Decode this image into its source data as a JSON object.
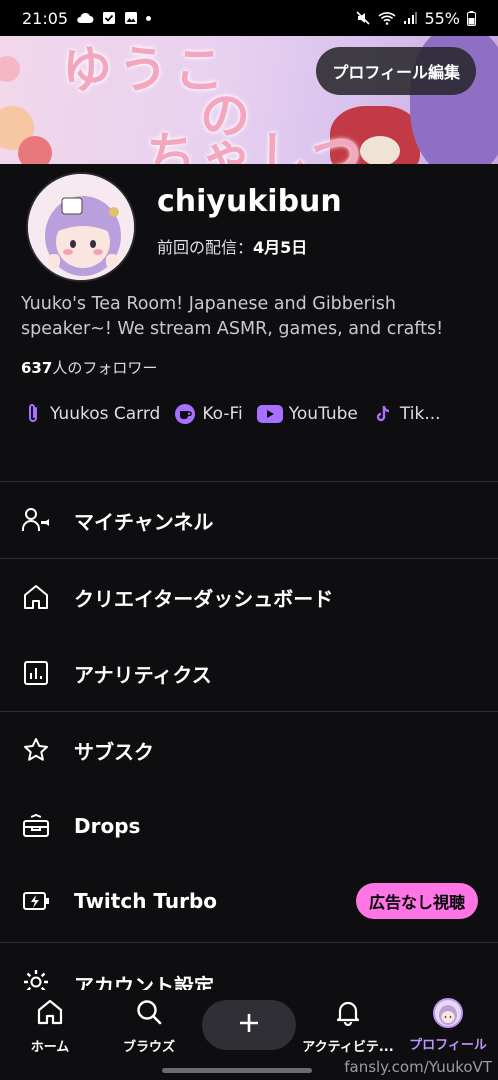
{
  "status_bar": {
    "time": "21:05",
    "battery": "55%"
  },
  "banner": {
    "text_line1": "ゆうこ",
    "text_line2": "の",
    "text_line3": "ちゃしつ",
    "edit_button": "プロフィール編集"
  },
  "profile": {
    "username": "chiyukibun",
    "last_stream_label": "前回の配信：",
    "last_stream_date": "4月5日",
    "bio": "Yuuko's Tea Room! Japanese and Gibberish speaker~! We stream ASMR, games, and crafts!",
    "followers_count": "637",
    "followers_label": "人のフォロワー"
  },
  "links": [
    {
      "label": "Yuukos Carrd",
      "icon": "link-icon"
    },
    {
      "label": "Ko-Fi",
      "icon": "kofi-icon"
    },
    {
      "label": "YouTube",
      "icon": "youtube-icon"
    },
    {
      "label": "Tik...",
      "icon": "tiktok-icon"
    }
  ],
  "menu": {
    "my_channel": "マイチャンネル",
    "creator_dashboard": "クリエイターダッシュボード",
    "analytics": "アナリティクス",
    "subscriptions": "サブスク",
    "drops": "Drops",
    "turbo": "Twitch Turbo",
    "turbo_badge": "広告なし視聴",
    "account_settings": "アカウント設定"
  },
  "bottom_nav": {
    "home": "ホーム",
    "browse": "ブラウズ",
    "activity": "アクティビテ...",
    "profile": "プロフィール"
  },
  "watermark": "fansly.com/YuukoVT",
  "colors": {
    "accent": "#bf94ff",
    "badge": "#ff75e6",
    "background": "#0e0e10"
  }
}
